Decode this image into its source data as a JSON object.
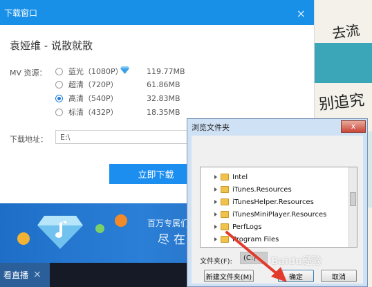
{
  "download_window": {
    "title": "下载窗口",
    "close_glyph": "×",
    "song_title": "袁娅维 - 说散就散",
    "mv_label": "MV 资源：",
    "options": [
      {
        "label": "蓝光（1080P）",
        "size": "119.77MB",
        "selected": false
      },
      {
        "label": "超清（720P）",
        "size": "61.86MB",
        "selected": false
      },
      {
        "label": "高清（540P）",
        "size": "32.83MB",
        "selected": true
      },
      {
        "label": "标清（432P）",
        "size": "18.35MB",
        "selected": false
      }
    ],
    "path_label": "下载地址：",
    "path_value": "E:\\",
    "download_button": "立即下载"
  },
  "banner": {
    "line1": "百万专属们",
    "line2": "尽在"
  },
  "taskbar": {
    "live_tab": "看直播",
    "live_close": "×"
  },
  "browse_dialog": {
    "title": "浏览文件夹",
    "close_glyph": "x",
    "folders": [
      "Intel",
      "iTunes.Resources",
      "iTunesHelper.Resources",
      "iTunesMiniPlayer.Resources",
      "PerfLogs",
      "Program Files"
    ],
    "folder_label": "文件夹(F):",
    "folder_value": "(C:)",
    "new_folder_button": "新建文件夹(M)",
    "ok_button": "确定",
    "cancel_button": "取消"
  },
  "background": {
    "handwriting_top": "去流",
    "handwriting_mid": "别追究"
  },
  "watermark": "Baidu经验",
  "colors": {
    "titlebar_blue": "#1890e8",
    "button_blue": "#1b8ef0",
    "banner_blue": "#2b7fd6",
    "dialog_frame": "#cfe1f5",
    "arrow_red": "#e23a2b"
  }
}
